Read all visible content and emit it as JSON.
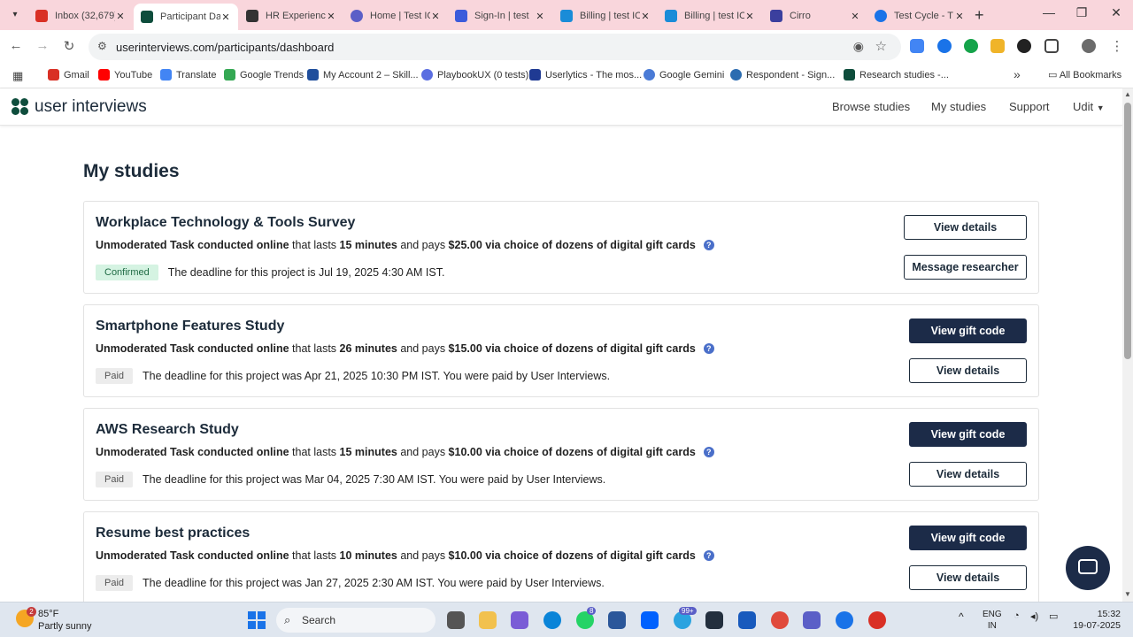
{
  "browser": {
    "tabs": [
      {
        "title": "Inbox (32,679)",
        "color": "#d93025",
        "active": false
      },
      {
        "title": "Participant Dashboard",
        "color": "#0e4d3c",
        "active": true
      },
      {
        "title": "HR Experience",
        "color": "#333333",
        "active": false
      },
      {
        "title": "Home | Test IO",
        "color": "#5b5fc7",
        "active": false
      },
      {
        "title": "Sign-In | test",
        "color": "#3b5bdb",
        "active": false
      },
      {
        "title": "Billing | test IO",
        "color": "#1a8cd8",
        "active": false
      },
      {
        "title": "Billing | test IO",
        "color": "#1a8cd8",
        "active": false
      },
      {
        "title": "Cirro",
        "color": "#3b3f9e",
        "active": false
      },
      {
        "title": "Test Cycle - T",
        "color": "#1a73e8",
        "active": false
      }
    ],
    "url": "userinterviews.com/participants/dashboard",
    "bookmarks": [
      {
        "label": "Gmail",
        "color": "#d93025"
      },
      {
        "label": "YouTube",
        "color": "#ff0000"
      },
      {
        "label": "Translate",
        "color": "#4285f4"
      },
      {
        "label": "Google Trends",
        "color": "#34a853"
      },
      {
        "label": "My Account 2 – Skill...",
        "color": "#1f4e9c"
      },
      {
        "label": "PlaybookUX (0 tests)",
        "color": "#5b6ee1"
      },
      {
        "label": "Userlytics - The mos...",
        "color": "#1f3a93"
      },
      {
        "label": "Google Gemini",
        "color": "#4a7bd6"
      },
      {
        "label": "Respondent - Sign...",
        "color": "#2b6cb0"
      },
      {
        "label": "Research studies -...",
        "color": "#0e4d3c"
      }
    ],
    "all_bookmarks": "All Bookmarks"
  },
  "site": {
    "logo": "user interviews",
    "nav": {
      "browse": "Browse studies",
      "my_studies": "My studies",
      "support": "Support",
      "user": "Udit"
    }
  },
  "page_title": "My studies",
  "studies": [
    {
      "title": "Workplace Technology & Tools Survey",
      "task": "Unmoderated Task conducted online",
      "lasts_word": " that lasts ",
      "duration": "15 minutes",
      "pays_word": " and pays ",
      "reward": "$25.00 via choice of dozens of digital gift cards",
      "status": "Confirmed",
      "deadline": "The deadline for this project is Jul 19, 2025 4:30 AM IST.",
      "primary_button": "View details",
      "secondary_button": "Message researcher"
    },
    {
      "title": "Smartphone Features Study",
      "task": "Unmoderated Task conducted online",
      "lasts_word": " that lasts ",
      "duration": "26 minutes",
      "pays_word": " and pays ",
      "reward": "$15.00 via choice of dozens of digital gift cards",
      "status": "Paid",
      "deadline": "The deadline for this project was Apr 21, 2025 10:30 PM IST. You were paid by User Interviews.",
      "primary_button": "View gift code",
      "secondary_button": "View details"
    },
    {
      "title": "AWS Research Study",
      "task": "Unmoderated Task conducted online",
      "lasts_word": " that lasts ",
      "duration": "15 minutes",
      "pays_word": " and pays ",
      "reward": "$10.00 via choice of dozens of digital gift cards",
      "status": "Paid",
      "deadline": "The deadline for this project was Mar 04, 2025 7:30 AM IST. You were paid by User Interviews.",
      "primary_button": "View gift code",
      "secondary_button": "View details"
    },
    {
      "title": "Resume best practices",
      "task": "Unmoderated Task conducted online",
      "lasts_word": " that lasts ",
      "duration": "10 minutes",
      "pays_word": " and pays ",
      "reward": "$10.00 via choice of dozens of digital gift cards",
      "status": "Paid",
      "deadline": "The deadline for this project was Jan 27, 2025 2:30 AM IST. You were paid by User Interviews.",
      "primary_button": "View gift code",
      "secondary_button": "View details"
    }
  ],
  "taskbar": {
    "weather_badge": "2",
    "temperature": "85°F",
    "condition": "Partly sunny",
    "search": "Search",
    "badge_whatsapp": "8",
    "badge_music": "99+",
    "lang_top": "ENG",
    "lang_bottom": "IN",
    "time": "15:32",
    "date": "19-07-2025"
  },
  "colors": {
    "brand_green": "#0e4d3c",
    "navy": "#1c2b48",
    "confirmed_bg": "#d5f3e2",
    "tab_strip": "#f9d6dc"
  }
}
